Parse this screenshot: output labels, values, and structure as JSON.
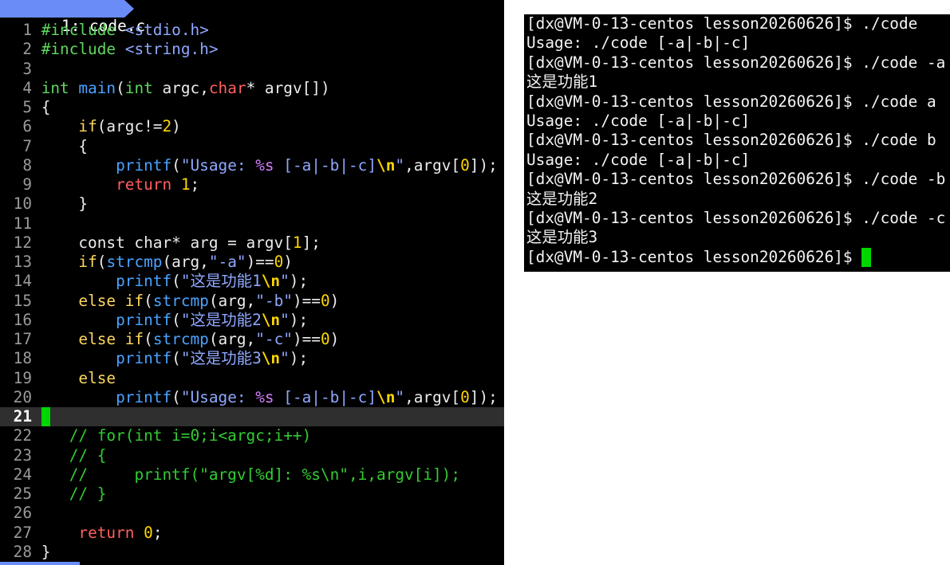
{
  "editor": {
    "tab_label": "1: code.c",
    "tab_color": "#6a8cf6",
    "cursor_color": "#00d700",
    "lines": [
      {
        "num": "1",
        "tokens": [
          {
            "t": "#include",
            "c": "#5fd75f"
          },
          {
            "t": " "
          },
          {
            "t": "<stdio.h>",
            "c": "#8fa8ff"
          }
        ]
      },
      {
        "num": "2",
        "tokens": [
          {
            "t": "#include",
            "c": "#5fd75f"
          },
          {
            "t": " "
          },
          {
            "t": "<string.h>",
            "c": "#8fa8ff"
          }
        ]
      },
      {
        "num": "3",
        "tokens": []
      },
      {
        "num": "4",
        "tokens": [
          {
            "t": "int",
            "c": "#5fd75f"
          },
          {
            "t": " "
          },
          {
            "t": "main",
            "c": "#4aa3ff"
          },
          {
            "t": "("
          },
          {
            "t": "int",
            "c": "#5fd75f"
          },
          {
            "t": " argc,"
          },
          {
            "t": "char",
            "c": "#ff5f5f"
          },
          {
            "t": "* argv[])"
          }
        ]
      },
      {
        "num": "5",
        "tokens": [
          {
            "t": "{"
          }
        ]
      },
      {
        "num": "6",
        "tokens": [
          {
            "t": "    "
          },
          {
            "t": "if",
            "c": "#ffd75f"
          },
          {
            "t": "(argc!="
          },
          {
            "t": "2",
            "c": "#ffd700"
          },
          {
            "t": ")"
          }
        ]
      },
      {
        "num": "7",
        "tokens": [
          {
            "t": "    {"
          }
        ]
      },
      {
        "num": "8",
        "tokens": [
          {
            "t": "        "
          },
          {
            "t": "printf",
            "c": "#4aa3ff"
          },
          {
            "t": "("
          },
          {
            "t": "\"Usage: ",
            "c": "#8fa8ff"
          },
          {
            "t": "%s",
            "c": "#d77fff"
          },
          {
            "t": " [-a|-b|-c]",
            "c": "#8fa8ff"
          },
          {
            "t": "\\n",
            "c": "#ffd700",
            "b": true
          },
          {
            "t": "\"",
            "c": "#8fa8ff"
          },
          {
            "t": ",argv["
          },
          {
            "t": "0",
            "c": "#ffd700"
          },
          {
            "t": "]);"
          }
        ]
      },
      {
        "num": "9",
        "tokens": [
          {
            "t": "        "
          },
          {
            "t": "return",
            "c": "#ff5f5f"
          },
          {
            "t": " "
          },
          {
            "t": "1",
            "c": "#ffd700"
          },
          {
            "t": ";"
          }
        ]
      },
      {
        "num": "10",
        "tokens": [
          {
            "t": "    }"
          }
        ]
      },
      {
        "num": "11",
        "tokens": []
      },
      {
        "num": "12",
        "tokens": [
          {
            "t": "    const char* arg = argv["
          },
          {
            "t": "1",
            "c": "#ffd700"
          },
          {
            "t": "];"
          }
        ]
      },
      {
        "num": "13",
        "tokens": [
          {
            "t": "    "
          },
          {
            "t": "if",
            "c": "#ffd75f"
          },
          {
            "t": "("
          },
          {
            "t": "strcmp",
            "c": "#4aa3ff"
          },
          {
            "t": "(arg,"
          },
          {
            "t": "\"-a\"",
            "c": "#8fa8ff"
          },
          {
            "t": ")=="
          },
          {
            "t": "0",
            "c": "#ffd700"
          },
          {
            "t": ")"
          }
        ]
      },
      {
        "num": "14",
        "tokens": [
          {
            "t": "        "
          },
          {
            "t": "printf",
            "c": "#4aa3ff"
          },
          {
            "t": "("
          },
          {
            "t": "\"这是功能1",
            "c": "#8fa8ff"
          },
          {
            "t": "\\n",
            "c": "#ffd700",
            "b": true
          },
          {
            "t": "\"",
            "c": "#8fa8ff"
          },
          {
            "t": ");"
          }
        ]
      },
      {
        "num": "15",
        "tokens": [
          {
            "t": "    "
          },
          {
            "t": "else if",
            "c": "#ffd75f"
          },
          {
            "t": "("
          },
          {
            "t": "strcmp",
            "c": "#4aa3ff"
          },
          {
            "t": "(arg,"
          },
          {
            "t": "\"-b\"",
            "c": "#8fa8ff"
          },
          {
            "t": ")=="
          },
          {
            "t": "0",
            "c": "#ffd700"
          },
          {
            "t": ")"
          }
        ]
      },
      {
        "num": "16",
        "tokens": [
          {
            "t": "        "
          },
          {
            "t": "printf",
            "c": "#4aa3ff"
          },
          {
            "t": "("
          },
          {
            "t": "\"这是功能2",
            "c": "#8fa8ff"
          },
          {
            "t": "\\n",
            "c": "#ffd700",
            "b": true
          },
          {
            "t": "\"",
            "c": "#8fa8ff"
          },
          {
            "t": ");"
          }
        ]
      },
      {
        "num": "17",
        "tokens": [
          {
            "t": "    "
          },
          {
            "t": "else if",
            "c": "#ffd75f"
          },
          {
            "t": "("
          },
          {
            "t": "strcmp",
            "c": "#4aa3ff"
          },
          {
            "t": "(arg,"
          },
          {
            "t": "\"-c\"",
            "c": "#8fa8ff"
          },
          {
            "t": ")=="
          },
          {
            "t": "0",
            "c": "#ffd700"
          },
          {
            "t": ")"
          }
        ]
      },
      {
        "num": "18",
        "tokens": [
          {
            "t": "        "
          },
          {
            "t": "printf",
            "c": "#4aa3ff"
          },
          {
            "t": "("
          },
          {
            "t": "\"这是功能3",
            "c": "#8fa8ff"
          },
          {
            "t": "\\n",
            "c": "#ffd700",
            "b": true
          },
          {
            "t": "\"",
            "c": "#8fa8ff"
          },
          {
            "t": ");"
          }
        ]
      },
      {
        "num": "19",
        "tokens": [
          {
            "t": "    "
          },
          {
            "t": "else",
            "c": "#ffd75f"
          }
        ]
      },
      {
        "num": "20",
        "tokens": [
          {
            "t": "        "
          },
          {
            "t": "printf",
            "c": "#4aa3ff"
          },
          {
            "t": "("
          },
          {
            "t": "\"Usage: ",
            "c": "#8fa8ff"
          },
          {
            "t": "%s",
            "c": "#d77fff"
          },
          {
            "t": " [-a|-b|-c]",
            "c": "#8fa8ff"
          },
          {
            "t": "\\n",
            "c": "#ffd700",
            "b": true
          },
          {
            "t": "\"",
            "c": "#8fa8ff"
          },
          {
            "t": ",argv["
          },
          {
            "t": "0",
            "c": "#ffd700"
          },
          {
            "t": "]);"
          }
        ]
      },
      {
        "num": "21",
        "current": true,
        "tokens": []
      },
      {
        "num": "22",
        "tokens": [
          {
            "t": "   "
          },
          {
            "t": "// for(int i=0;i<argc;i++)",
            "c": "#33cc33"
          }
        ]
      },
      {
        "num": "23",
        "tokens": [
          {
            "t": "   "
          },
          {
            "t": "// {",
            "c": "#33cc33"
          }
        ]
      },
      {
        "num": "24",
        "tokens": [
          {
            "t": "   "
          },
          {
            "t": "//     printf(\"argv[%d]: %s\\n\",i,argv[i]);",
            "c": "#33cc33"
          }
        ]
      },
      {
        "num": "25",
        "tokens": [
          {
            "t": "   "
          },
          {
            "t": "// }",
            "c": "#33cc33"
          }
        ]
      },
      {
        "num": "26",
        "tokens": []
      },
      {
        "num": "27",
        "tokens": [
          {
            "t": "    "
          },
          {
            "t": "return",
            "c": "#ff5f5f"
          },
          {
            "t": " "
          },
          {
            "t": "0",
            "c": "#ffd700"
          },
          {
            "t": ";"
          }
        ]
      },
      {
        "num": "28",
        "tokens": [
          {
            "t": "}"
          }
        ]
      }
    ]
  },
  "terminal": {
    "cursor_color": "#00d700",
    "lines": [
      "[dx@VM-0-13-centos lesson20260626]$ ./code",
      "Usage: ./code [-a|-b|-c]",
      "[dx@VM-0-13-centos lesson20260626]$ ./code -a",
      "这是功能1",
      "[dx@VM-0-13-centos lesson20260626]$ ./code a",
      "Usage: ./code [-a|-b|-c]",
      "[dx@VM-0-13-centos lesson20260626]$ ./code b",
      "Usage: ./code [-a|-b|-c]",
      "[dx@VM-0-13-centos lesson20260626]$ ./code -b",
      "这是功能2",
      "[dx@VM-0-13-centos lesson20260626]$ ./code -c",
      "这是功能3"
    ],
    "prompt": "[dx@VM-0-13-centos lesson20260626]$ "
  }
}
